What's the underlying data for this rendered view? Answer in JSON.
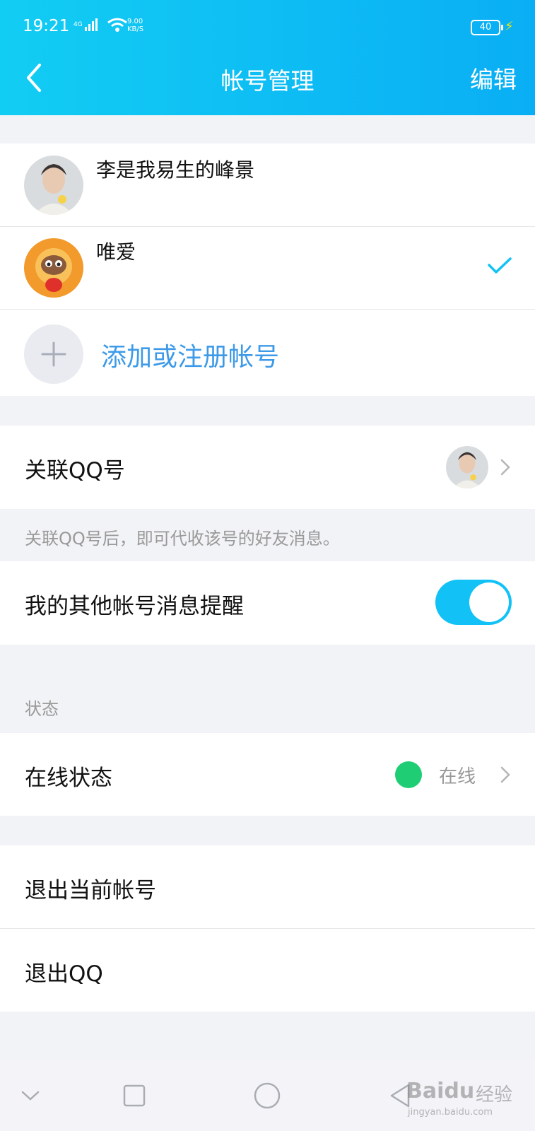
{
  "status_bar": {
    "time": "19:21",
    "network": "4G",
    "speed_value": "9.00",
    "speed_unit": "KB/S",
    "battery": "40"
  },
  "header": {
    "title": "帐号管理",
    "edit_label": "编辑",
    "back_icon": "chevron-left-icon"
  },
  "accounts": [
    {
      "name": "李是我易生的峰景",
      "selected": false
    },
    {
      "name": "唯爱",
      "selected": true
    }
  ],
  "add_account_label": "添加或注册帐号",
  "linked_qq": {
    "label": "关联QQ号",
    "hint": "关联QQ号后，即可代收该号的好友消息。"
  },
  "other_account_notice": {
    "label": "我的其他帐号消息提醒",
    "enabled": true
  },
  "status_section": {
    "title": "状态",
    "online_label": "在线状态",
    "online_value": "在线",
    "online_color": "#1fcd74"
  },
  "logout": {
    "current_account": "退出当前帐号",
    "quit_qq": "退出QQ"
  },
  "colors": {
    "accent": "#12c2f7",
    "link": "#3d9ae8"
  },
  "watermark": {
    "brand": "Baidu",
    "cn": "经验",
    "url": "jingyan.baidu.com"
  }
}
